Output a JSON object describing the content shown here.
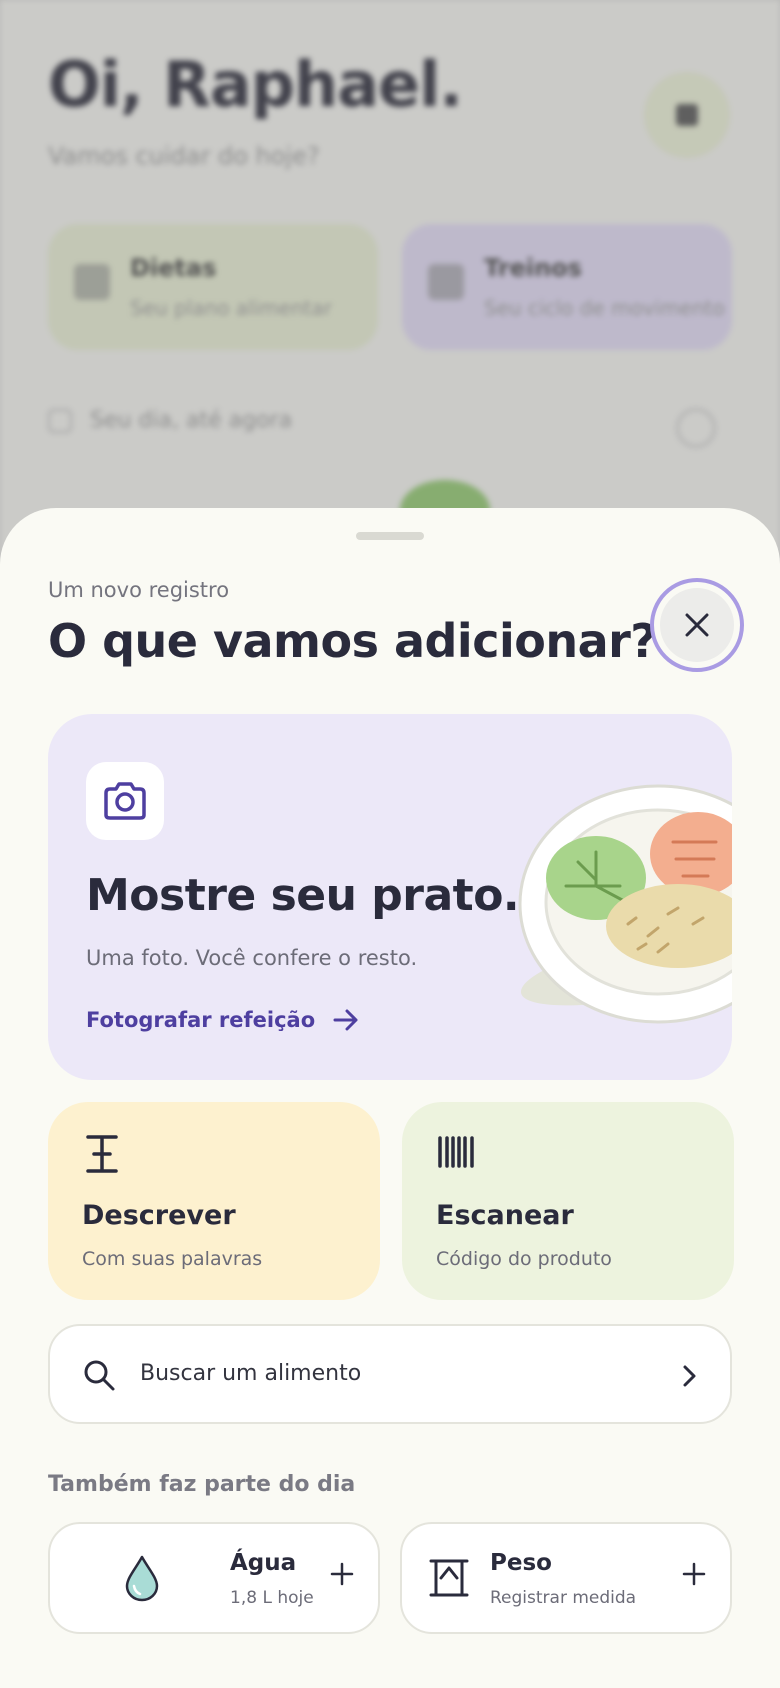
{
  "background": {
    "greeting": "Oi, Raphael.",
    "subtitle": "Vamos cuidar do hoje?",
    "cards": [
      {
        "title": "Dietas",
        "subtitle": "Seu plano alimentar"
      },
      {
        "title": "Treinos",
        "subtitle": "Seu ciclo de movimento"
      }
    ],
    "day_row": "Seu dia, até agora"
  },
  "sheet": {
    "eyebrow": "Um novo registro",
    "title": "O que vamos adicionar?",
    "close_icon": "close-icon"
  },
  "hero": {
    "icon": "camera-icon",
    "title": "Mostre seu prato.",
    "subtitle": "Uma foto. Você confere o resto.",
    "link": "Fotografar refeição",
    "colors": {
      "background": "#ece8f8",
      "accent": "#4e3fa0"
    }
  },
  "options": [
    {
      "title": "Descrever",
      "subtitle": "Com suas palavras",
      "icon": "text-cursor-icon",
      "color": "#fdf1cf"
    },
    {
      "title": "Escanear",
      "subtitle": "Código do produto",
      "icon": "barcode-icon",
      "color": "#edf3de"
    }
  ],
  "search": {
    "placeholder": "Buscar um alimento",
    "icon": "search-icon"
  },
  "section_title": "Também faz parte do dia",
  "tiles": [
    {
      "title": "Água",
      "subtitle": "1,8 L hoje",
      "icon": "water-drop-icon"
    },
    {
      "title": "Peso",
      "subtitle": "Registrar medida",
      "icon": "scale-icon"
    }
  ]
}
